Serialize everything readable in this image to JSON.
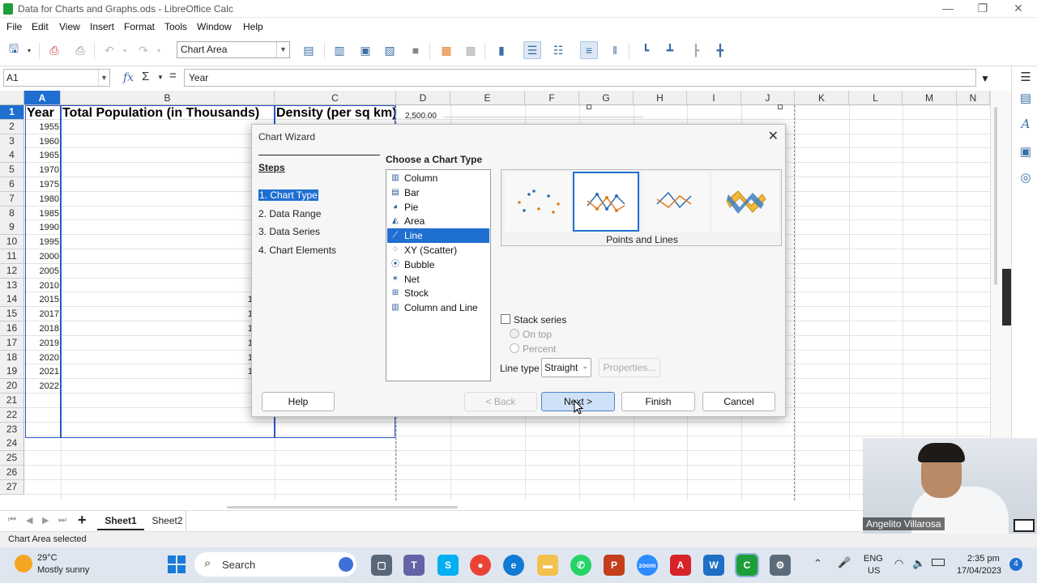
{
  "window": {
    "title": "Data for Charts and Graphs.ods - LibreOffice Calc",
    "controls": [
      "—",
      "❐",
      "✕"
    ]
  },
  "menu": [
    "File",
    "Edit",
    "View",
    "Insert",
    "Format",
    "Tools",
    "Window",
    "Help"
  ],
  "toolbar": {
    "chart_element_select": "Chart Area"
  },
  "formula_bar": {
    "cell_ref": "A1",
    "content": "Year"
  },
  "columns": [
    "A",
    "B",
    "C",
    "D",
    "E",
    "F",
    "G",
    "H",
    "I",
    "J",
    "K",
    "L",
    "M",
    "N"
  ],
  "rows": [
    "1",
    "2",
    "3",
    "4",
    "5",
    "6",
    "7",
    "8",
    "9",
    "10",
    "11",
    "12",
    "13",
    "14",
    "15",
    "16",
    "17",
    "18",
    "19",
    "20",
    "21",
    "22",
    "23",
    "24",
    "25",
    "26",
    "27"
  ],
  "sheet": {
    "headers": {
      "a1": "Year",
      "b1": "Total Population (in Thousands)",
      "c1": "Density (per sq km)"
    },
    "years": [
      "1955",
      "1960",
      "1965",
      "1970",
      "1975",
      "1980",
      "1985",
      "1990",
      "1995",
      "2000",
      "2005",
      "2010",
      "2015",
      "2017",
      "2018",
      "2019",
      "2020",
      "2021",
      "2022"
    ],
    "b_partial": [
      "1",
      "1",
      "1",
      "1",
      "1",
      "1"
    ],
    "chart_axis_label": "2,500.00"
  },
  "dialog": {
    "title": "Chart Wizard",
    "steps_heading": "Steps",
    "steps": [
      "1. Chart Type",
      "2. Data Range",
      "3. Data Series",
      "4. Chart Elements"
    ],
    "choose_heading": "Choose a Chart Type",
    "chart_types": [
      "Column",
      "Bar",
      "Pie",
      "Area",
      "Line",
      "XY (Scatter)",
      "Bubble",
      "Net",
      "Stock",
      "Column and Line"
    ],
    "selected_type": "Line",
    "variant_label": "Points and Lines",
    "stack_series": "Stack series",
    "on_top": "On top",
    "percent": "Percent",
    "line_type_label": "Line type",
    "line_type_value": "Straight",
    "properties": "Properties...",
    "buttons": {
      "help": "Help",
      "back": "< Back",
      "next": "Next >",
      "finish": "Finish",
      "cancel": "Cancel"
    }
  },
  "sheet_tabs": [
    "Sheet1",
    "Sheet2"
  ],
  "status": "Chart Area selected",
  "webcam_name": "Angelito Villarosa",
  "taskbar": {
    "weather_temp": "29°C",
    "weather_desc": "Mostly sunny",
    "search": "Search",
    "lang1": "ENG",
    "lang2": "US",
    "time": "2:35 pm",
    "date": "17/04/2023",
    "notif": "4"
  }
}
